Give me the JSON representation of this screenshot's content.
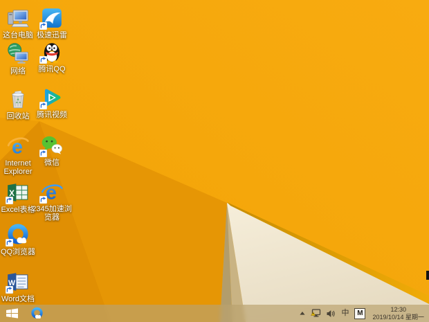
{
  "wallpaper": {
    "base_orange_top": "#f8ab10",
    "base_orange_bottom": "#f2a306",
    "notch_orange": "#ee9e06",
    "dark_orange_left": "#e08f03",
    "dark_orange_mid": "#e69605",
    "tan_dark": "#b29d6c",
    "tan_light": "#c9b383",
    "cream_light": "#f6eeda",
    "cream_dark": "#e7dcc3",
    "gold_left": "#c88d00",
    "gold_right": "#f0ab08"
  },
  "desktop": {
    "col1": [
      {
        "label": "这台电脑"
      },
      {
        "label": "网络"
      },
      {
        "label": "回收站"
      },
      {
        "label": "Internet Explorer"
      },
      {
        "label": "Excel表格"
      },
      {
        "label": "QQ浏览器"
      },
      {
        "label": "Word文档"
      }
    ],
    "col2": [
      {
        "label": "极速迅雷"
      },
      {
        "label": "腾讯QQ"
      },
      {
        "label": "腾讯视频"
      },
      {
        "label": "微信"
      },
      {
        "label": "2345加速浏览器"
      }
    ]
  },
  "taskbar": {
    "ime_mode": "中",
    "ime_indicator": "M",
    "clock": {
      "time": "12:30",
      "date": "2019/10/14 星期一"
    }
  }
}
